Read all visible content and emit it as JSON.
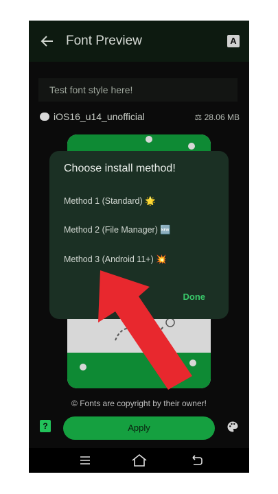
{
  "appbar": {
    "title": "Font Preview",
    "back_icon": "arrow-left-icon",
    "font_icon_letter": "A"
  },
  "preview": {
    "placeholder": "Test font style here!"
  },
  "font": {
    "name": "iOS16_u14_unofficial",
    "size": "28.06 MB"
  },
  "dialog": {
    "title": "Choose install method!",
    "options": [
      {
        "label": "Method 1 (Standard) 🌟"
      },
      {
        "label": "Method 2 (File Manager) 🆕"
      },
      {
        "label": "Method 3 (Android 11+) 💥"
      }
    ],
    "done_label": "Done"
  },
  "footer": {
    "copyright": "© Fonts are copyright by their owner!",
    "apply_label": "Apply",
    "help_glyph": "?"
  },
  "colors": {
    "accent_green": "#15a040",
    "dialog_bg": "#1b3024",
    "arrow_red": "#e8282e"
  }
}
